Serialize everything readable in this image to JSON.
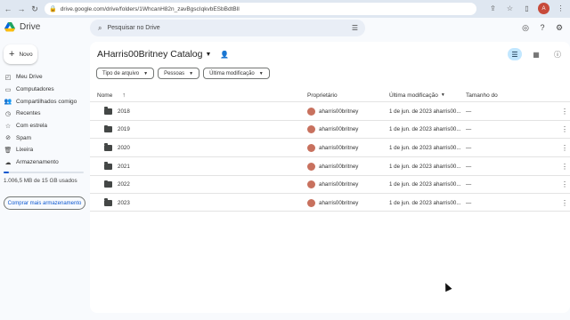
{
  "browser": {
    "url": "drive.google.com/drive/folders/1WhcanH82n_zavBgscIqkvbESbBdtBlI",
    "back_icon": "arrow-left-icon",
    "forward_icon": "arrow-right-icon",
    "reload_icon": "reload-icon"
  },
  "app": {
    "name": "Drive",
    "search_placeholder": "Pesquisar no Drive"
  },
  "new_button": {
    "label": "Novo"
  },
  "sidebar": {
    "items": [
      {
        "label": "Meu Drive",
        "icon": "drive-icon"
      },
      {
        "label": "Computadores",
        "icon": "computer-icon"
      },
      {
        "label": "Compartilhados comigo",
        "icon": "shared-icon"
      },
      {
        "label": "Recentes",
        "icon": "clock-icon"
      },
      {
        "label": "Com estrela",
        "icon": "star-icon"
      },
      {
        "label": "Spam",
        "icon": "spam-icon"
      },
      {
        "label": "Lixeira",
        "icon": "trash-icon"
      },
      {
        "label": "Armazenamento",
        "icon": "cloud-icon"
      }
    ],
    "storage_text": "1.006,5 MB de 15 GB usados",
    "storage_fraction": 0.067,
    "buy_storage_label": "Comprar mais armazenamento"
  },
  "folder": {
    "title": "AHarris00Britney Catalog",
    "filters": [
      "Tipo de arquivo",
      "Pessoas",
      "Última modificação"
    ],
    "columns": {
      "name": "Nome",
      "owner": "Proprietário",
      "modified": "Última modificação",
      "size": "Tamanho do"
    },
    "rows": [
      {
        "name": "2018",
        "owner": "aharris00britney",
        "modified": "1 de jun. de 2023 aharris00...",
        "size": "—"
      },
      {
        "name": "2019",
        "owner": "aharris00britney",
        "modified": "1 de jun. de 2023 aharris00...",
        "size": "—"
      },
      {
        "name": "2020",
        "owner": "aharris00britney",
        "modified": "1 de jun. de 2023 aharris00...",
        "size": "—"
      },
      {
        "name": "2021",
        "owner": "aharris00britney",
        "modified": "1 de jun. de 2023 aharris00...",
        "size": "—"
      },
      {
        "name": "2022",
        "owner": "aharris00britney",
        "modified": "1 de jun. de 2023 aharris00...",
        "size": "—"
      },
      {
        "name": "2023",
        "owner": "aharris00britney",
        "modified": "1 de jun. de 2023 aharris00...",
        "size": "—"
      }
    ]
  },
  "colors": {
    "accent": "#0b57d0",
    "selected_chip": "#c2e7ff",
    "owner_avatar": "#c8715e"
  }
}
